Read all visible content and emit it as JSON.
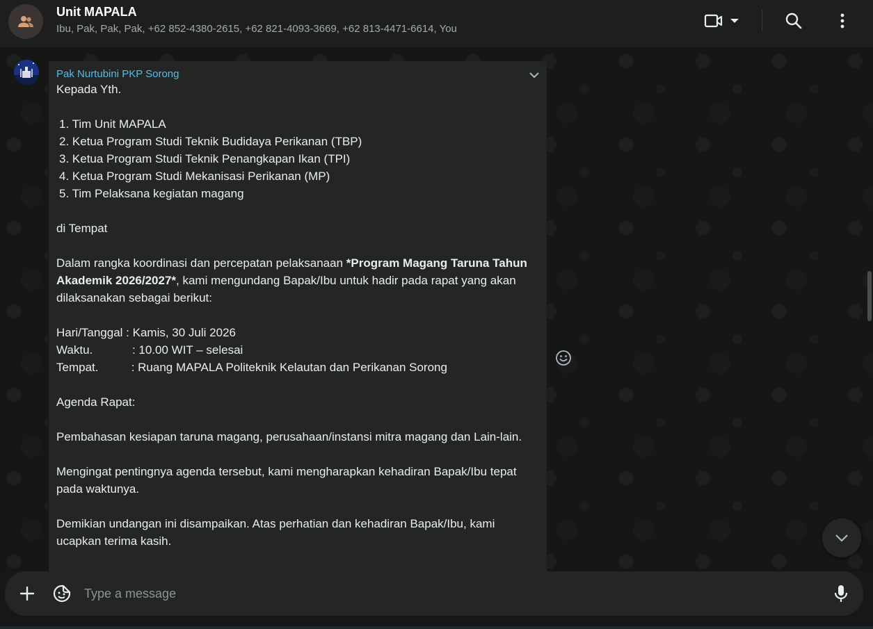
{
  "header": {
    "title": "Unit MAPALA",
    "members": "Ibu, Pak, Pak, Pak, +62 852-4380-2615, +62 821-4093-3669, +62 813-4471-6614, You",
    "icons": [
      "group-icon",
      "video-call-icon",
      "chevron-down-icon",
      "search-icon",
      "more-vertical-icon"
    ]
  },
  "message": {
    "sender": "Pak Nurtubini PKP Sorong",
    "salutation": "Kepada Yth.",
    "recipients": [
      "1.  Tim Unit MAPALA",
      "2.  Ketua Program Studi Teknik Budidaya Perikanan (TBP)",
      "3.  Ketua Program Studi Teknik Penangkapan Ikan (TPI)",
      "4.  Ketua Program Studi Mekanisasi Perikanan (MP)",
      "5.  Tim Pelaksana kegiatan magang"
    ],
    "place": "di Tempat",
    "intro_before": "Dalam rangka koordinasi dan percepatan pelaksanaan ",
    "intro_bold": "*Program Magang Taruna Tahun Akademik 2026/2027*",
    "intro_after": ", kami mengundang Bapak/Ibu untuk hadir pada rapat yang akan dilaksanakan sebagai berikut:",
    "schedule": [
      "Hari/Tanggal : Kamis, 30 Juli 2026",
      "Waktu.            : 10.00 WIT – selesai",
      "Tempat.          : Ruang MAPALA Politeknik Kelautan dan Perikanan Sorong"
    ],
    "agenda_title": "Agenda Rapat:",
    "agenda_body": "Pembahasan kesiapan taruna magang, perusahaan/instansi mitra magang dan Lain-lain.",
    "closing_1": "Mengingat pentingnya agenda tersebut, kami mengharapkan kehadiran Bapak/Ibu tepat pada waktunya.",
    "closing_2": "Demikian undangan ini disampaikan. Atas perhatian dan kehadiran Bapak/Ibu, kami ucapkan terima kasih."
  },
  "composer": {
    "placeholder": "Type a message",
    "icons": [
      "plus-icon",
      "sticker-icon",
      "microphone-icon"
    ]
  },
  "colors": {
    "accent_sender": "#53bdeb",
    "bubble": "#242626",
    "header": "#1d1f1f",
    "background": "#151616"
  }
}
